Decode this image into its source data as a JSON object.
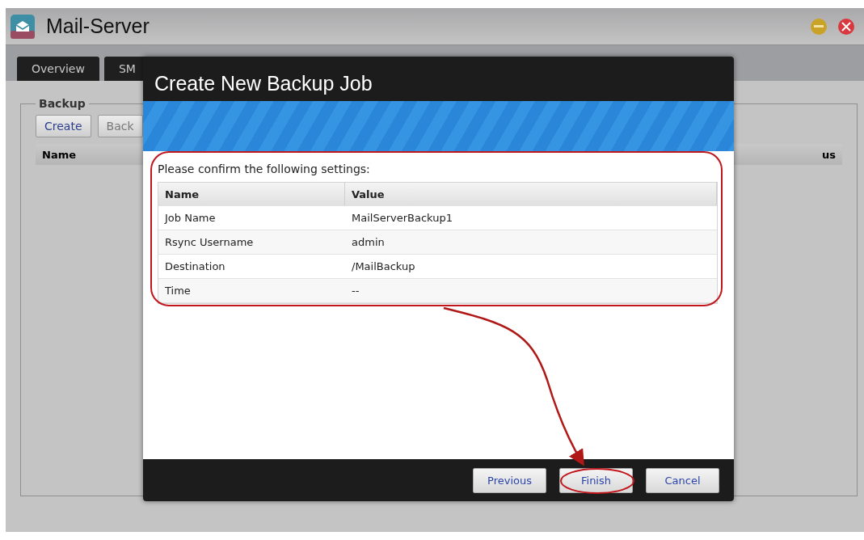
{
  "window": {
    "title": "Mail-Server"
  },
  "tabs": [
    {
      "label": "Overview"
    },
    {
      "label": "SM"
    }
  ],
  "backup_panel": {
    "legend": "Backup",
    "buttons": [
      "Create",
      "Back"
    ],
    "columns": [
      "Name",
      "us"
    ]
  },
  "dialog": {
    "title": "Create New Backup Job",
    "prompt": "Please confirm the following settings:",
    "columns": [
      "Name",
      "Value"
    ],
    "rows": [
      {
        "name": "Job Name",
        "value": "MailServerBackup1"
      },
      {
        "name": "Rsync Username",
        "value": "admin"
      },
      {
        "name": "Destination",
        "value": "/MailBackup"
      },
      {
        "name": "Time",
        "value": "--"
      }
    ],
    "buttons": [
      "Previous",
      "Finish",
      "Cancel"
    ]
  }
}
